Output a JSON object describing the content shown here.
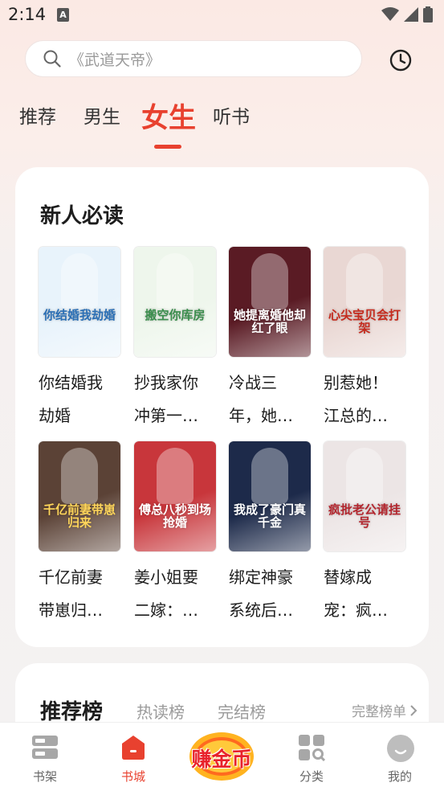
{
  "status": {
    "time": "2:14"
  },
  "search": {
    "placeholder": "《武道天帝》"
  },
  "tabs": [
    "推荐",
    "男生",
    "女生",
    "听书"
  ],
  "section1": {
    "title": "新人必读",
    "books": [
      {
        "name1": "你结婚我",
        "name2": "劫婚",
        "cover_text": "你结婚我劫婚",
        "cover_bg": "#e8f3fb",
        "cover_color": "#2b6fb5"
      },
      {
        "name1": "抄我家你",
        "name2": "冲第一…",
        "cover_text": "搬空你库房",
        "cover_bg": "#eef6ec",
        "cover_color": "#3b8d4d"
      },
      {
        "name1": "冷战三",
        "name2": "年，她…",
        "cover_text": "她提离婚他却红了眼",
        "cover_bg": "#5a1b24",
        "cover_color": "#ffffff"
      },
      {
        "name1": "别惹她！",
        "name2": "江总的…",
        "cover_text": "心尖宝贝会打架",
        "cover_bg": "#e9d7d3",
        "cover_color": "#c52a1d"
      },
      {
        "name1": "千亿前妻",
        "name2": "带崽归…",
        "cover_text": "千亿前妻带崽归来",
        "cover_bg": "#5b4236",
        "cover_color": "#ffd65a"
      },
      {
        "name1": "姜小姐要",
        "name2": "二嫁：…",
        "cover_text": "傅总八秒到场抢婚",
        "cover_bg": "#c8363b",
        "cover_color": "#ffffff"
      },
      {
        "name1": "绑定神豪",
        "name2": "系统后…",
        "cover_text": "我成了豪门真千金",
        "cover_bg": "#1d2a4a",
        "cover_color": "#ffffff"
      },
      {
        "name1": "替嫁成",
        "name2": "宠：疯…",
        "cover_text": "疯批老公请挂号",
        "cover_bg": "#ece5e5",
        "cover_color": "#b3262e"
      }
    ]
  },
  "ranking": {
    "title": "推荐榜",
    "tabs": [
      "热读榜",
      "完结榜"
    ],
    "more": "完整榜单"
  },
  "bottom_nav": {
    "items": [
      "书架",
      "书城",
      "分类",
      "我的"
    ],
    "earn_label": "赚金币"
  },
  "colors": {
    "accent": "#e8412f"
  }
}
